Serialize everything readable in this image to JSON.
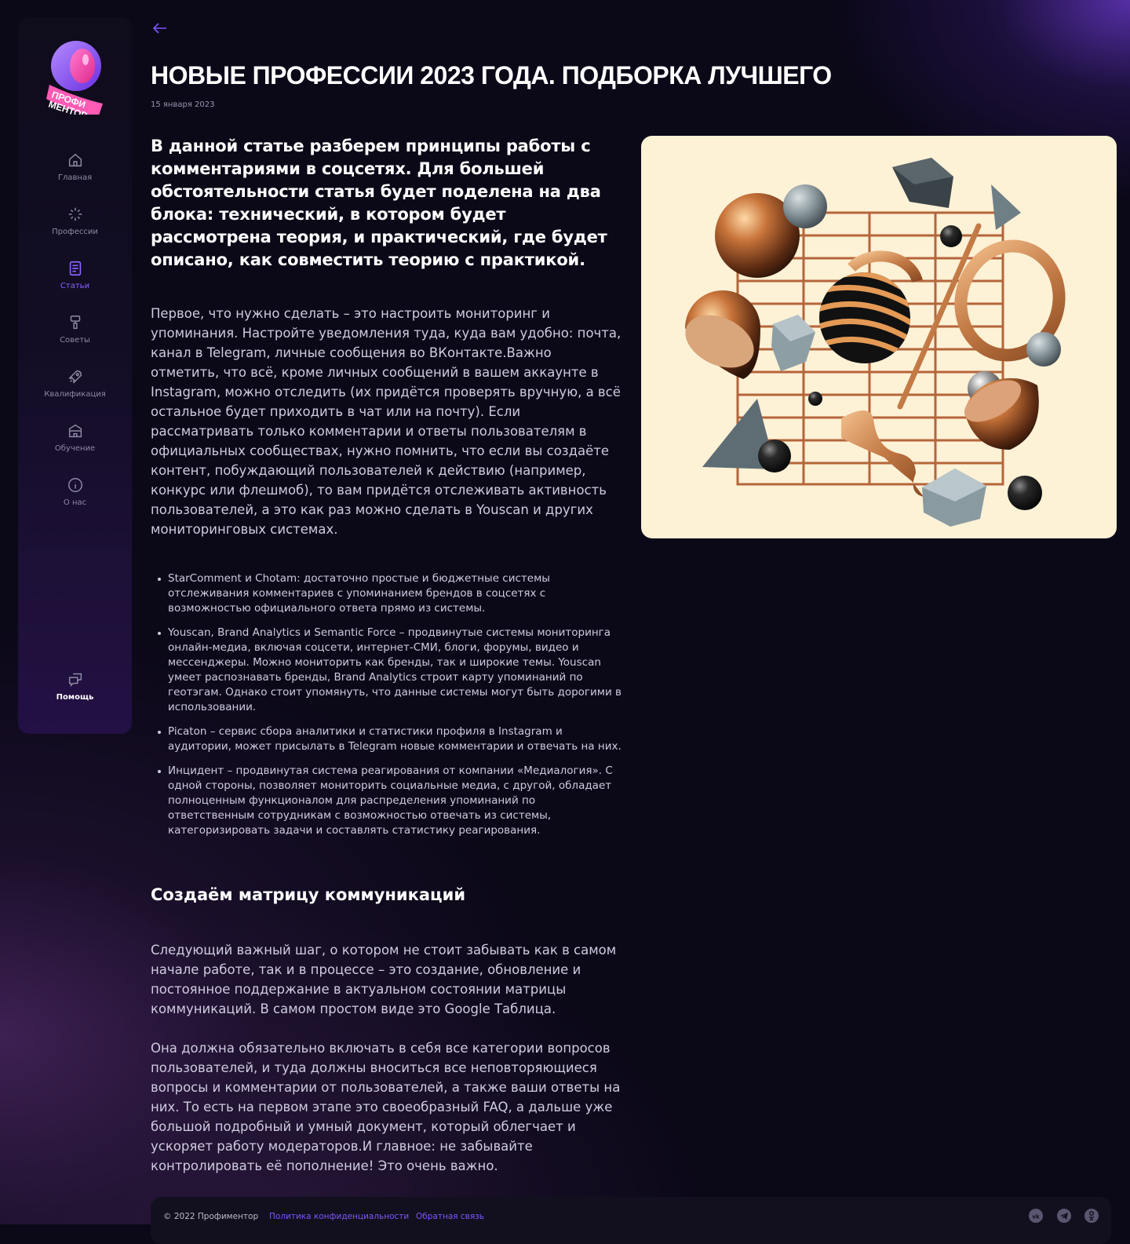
{
  "brand": {
    "logo_text_line1": "ПРОФИ",
    "logo_text_line2": "МЕНТОР"
  },
  "nav": {
    "items": [
      {
        "label": "Главная",
        "icon": "home-icon"
      },
      {
        "label": "Профессии",
        "icon": "sparkle-icon"
      },
      {
        "label": "Статьи",
        "icon": "article-icon",
        "active": true
      },
      {
        "label": "Советы",
        "icon": "brush-icon"
      },
      {
        "label": "Квалификация",
        "icon": "rocket-icon"
      },
      {
        "label": "Обучение",
        "icon": "school-icon"
      },
      {
        "label": "О нас",
        "icon": "info-icon"
      }
    ],
    "help_label": "Помощь"
  },
  "article": {
    "title": "НОВЫЕ ПРОФЕССИИ 2023 ГОДА. ПОДБОРКА ЛУЧШЕГО",
    "date": "15 января 2023",
    "lead": "В данной статье разберем принципы работы с комментариями в соцсетях. Для большей обстоятельности статья будет поделена на два блока: технический, в котором будет рассмотрена теория, и практический, где будет описано, как совместить теорию с практикой.",
    "p1": "Первое, что нужно сделать – это настроить мониторинг и упоминания. Настройте уведомления туда, куда вам удобно: почта, канал в Telegram, личные сообщения во ВКонтакте.Важно отметить, что всё, кроме личных сообщений в вашем аккаунте в Instagram, можно отследить (их придётся проверять вручную, а всё остальное будет приходить в чат или на почту). Если рассматривать только комментарии и ответы пользователям в официальных сообществах, нужно помнить, что если вы создаёте контент, побуждающий пользователей к действию (например, конкурс или флешмоб), то вам придётся отслеживать активность пользователей, а это как раз можно сделать в Youscan и других мониторинговых системах.",
    "list": [
      "StarComment и Chotam: достаточно простые и бюджетные системы отслеживания комментариев с упоминанием брендов в соцсетях с возможностью официального ответа прямо из системы.",
      "Youscan, Brand Analytics и Semantic Force – продвинутые системы мониторинга онлайн-медиа, включая соцсети, интернет-СМИ, блоги, форумы, видео и мессенджеры. Можно мониторить как бренды, так и широкие темы. Youscan умеет распознавать бренды, Brand Analytics строит карту упоминаний по геотэгам. Однако стоит упомянуть, что данные системы могут быть дорогими в использовании.",
      "Picaton – сервис сбора аналитики и статистики профиля в Instagram и аудитории, может присылать в Telegram новые комментарии и отвечать на них.",
      "Инцидент – продвинутая система реагирования от компании «Медиалогия». С одной стороны, позволяет мониторить социальные медиа, с другой, обладает полноценным функционалом для распределения упоминаний по ответственным сотрудникам с возможностью отвечать из системы, категоризировать задачи и составлять статистику реагирования."
    ],
    "h2": "Создаём матрицу коммуникаций",
    "p2": "Следующий важный шаг, о котором не стоит забывать как в самом начале работе, так и в процессе – это создание, обновление и постоянное поддержание в актуальном состоянии матрицы коммуникаций. В самом простом виде это Google Таблица.",
    "p3": "Она должна обязательно включать в себя все категории вопросов пользователей, и туда должны вноситься все неповторяющиеся вопросы и комментарии от пользователей, а также ваши ответы на них. То есть на первом этапе это своеобразный FAQ, а дальше уже большой подробный и умный документ, который облегчает и ускоряет работу модераторов.И главное: не забывайте контролировать её пополнение! Это очень важно."
  },
  "footer": {
    "copyright": "© 2022 Профиментор",
    "privacy": "Политика конфиденциальности",
    "feedback": "Обратная связь",
    "socials": [
      "vk-icon",
      "telegram-icon",
      "odnoklassniki-icon"
    ]
  },
  "colors": {
    "accent": "#7c56ff",
    "background": "#0b0818",
    "art_bg": "#fdf1d6"
  }
}
